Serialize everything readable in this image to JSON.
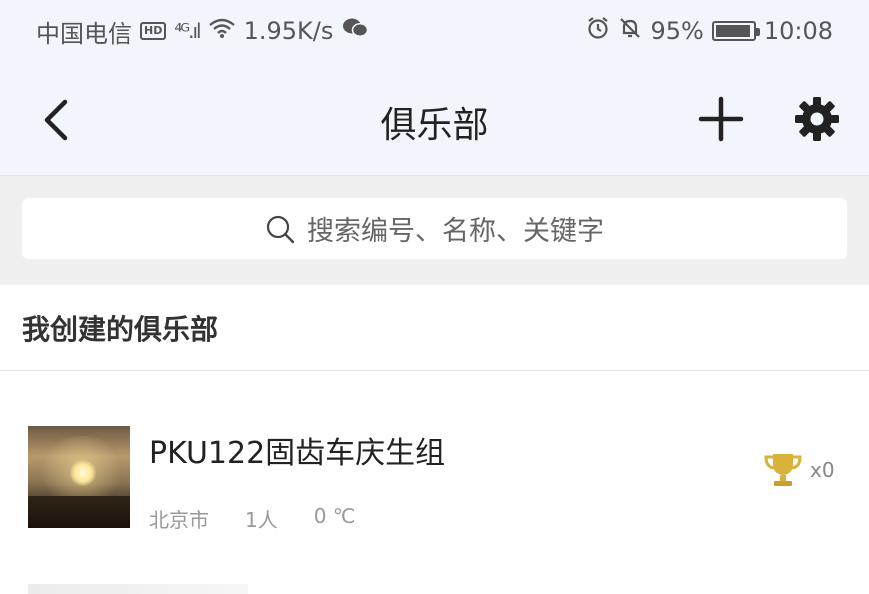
{
  "status_bar": {
    "carrier": "中国电信",
    "hd_badge": "HD",
    "network": "⁴ᴳ.ıl",
    "speed": "1.95K/s",
    "battery": "95%",
    "time": "10:08"
  },
  "nav": {
    "title": "俱乐部"
  },
  "search": {
    "placeholder": "搜索编号、名称、关键字"
  },
  "section": {
    "title": "我创建的俱乐部"
  },
  "clubs": [
    {
      "name": "PKU122固齿车庆生组",
      "city": "北京市",
      "members": "1人",
      "temperature": "0 ℃",
      "trophy_count": "x0"
    }
  ],
  "colors": {
    "header_bg": "#f2f6fc",
    "search_section_bg": "#f0f0f0",
    "trophy_gold": "#d8b23a"
  },
  "icons": [
    "back-arrow-icon",
    "plus-icon",
    "gear-icon",
    "search-icon",
    "trophy-icon",
    "wechat-icon",
    "wifi-icon",
    "alarm-icon",
    "mute-bell-icon",
    "battery-icon"
  ]
}
